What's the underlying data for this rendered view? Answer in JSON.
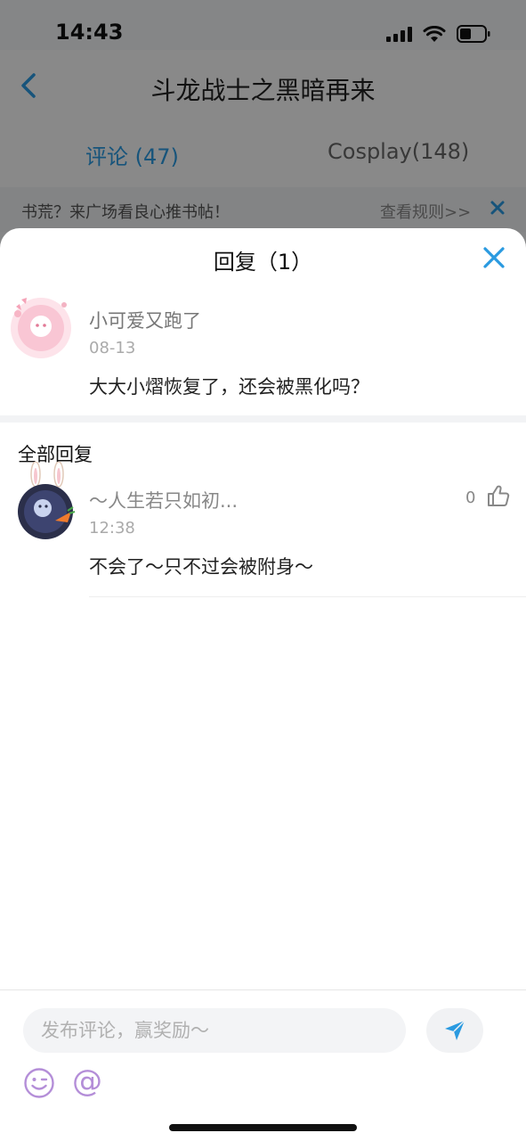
{
  "status_bar": {
    "time": "14:43"
  },
  "nav": {
    "title": "斗龙战士之黑暗再来"
  },
  "tabs": [
    {
      "label": "评论 (47)",
      "active": true
    },
    {
      "label": "Cosplay(148)",
      "active": false
    }
  ],
  "notice": {
    "text": "书荒？来广场看良心推书帖！",
    "link": "查看规则>>"
  },
  "sheet": {
    "title": "回复（1）",
    "original_comment": {
      "username": "小可爱又跑了",
      "date": "08-13",
      "text": "大大小熠恢复了，还会被黑化吗？"
    },
    "section_title": "全部回复",
    "replies": [
      {
        "username": "～人生若只如初...",
        "time": "12:38",
        "text": "不会了～只不过会被附身～",
        "likes": "0"
      }
    ]
  },
  "input": {
    "placeholder": "发布评论，赢奖励～"
  },
  "icons": {
    "back": "chevron-left-icon",
    "close": "close-icon",
    "like": "thumb-up-icon",
    "send": "send-icon",
    "emoji": "emoji-wink-icon",
    "at": "at-icon"
  },
  "colors": {
    "accent": "#2a9ae0",
    "emoji": "#b48ed8"
  }
}
